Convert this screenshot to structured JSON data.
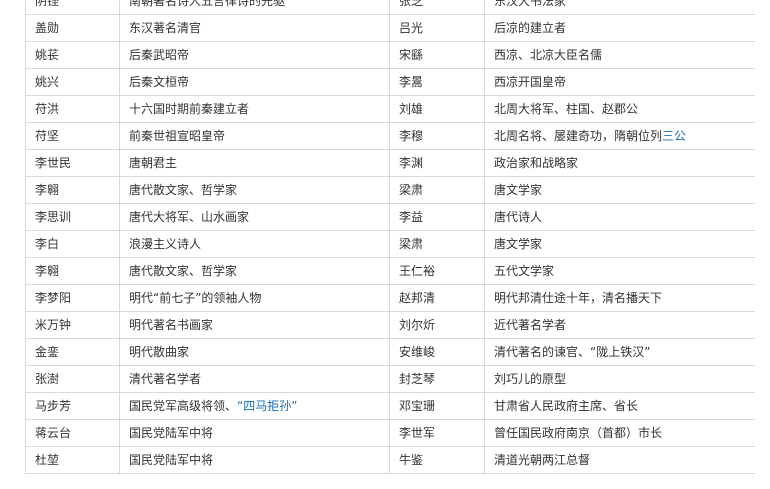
{
  "colors": {
    "link": "#136ec2",
    "text": "#333333",
    "border": "#d8d8d8"
  },
  "rows": [
    {
      "name1": "阴铿",
      "desc1": "南朝著名诗人五言律诗的先驱",
      "name2": "张芝",
      "desc2": "东汉大书法家"
    },
    {
      "name1": "盖勋",
      "desc1": "东汉著名清官",
      "name2": "吕光",
      "desc2": "后凉的建立者"
    },
    {
      "name1": "姚苌",
      "desc1": "后秦武昭帝",
      "name2": "宋繇",
      "desc2": "西凉、北凉大臣名儒"
    },
    {
      "name1": "姚兴",
      "desc1": "后秦文桓帝",
      "desc1_link": true,
      "name2": "李暠",
      "desc2": "西凉开国皇帝"
    },
    {
      "name1": "苻洪",
      "desc1": "十六国时期前秦建立者",
      "name2": "刘雄",
      "desc2": "北周大将军、柱国、赵郡公"
    },
    {
      "name1": "苻坚",
      "desc1": "前秦世祖宣昭皇帝",
      "name2": "李穆",
      "desc2_pre": "北周名将、屡建奇功，隋朝位列",
      "desc2_link": "三公"
    },
    {
      "name1": "李世民",
      "desc1": "唐朝君主",
      "name2": "李渊",
      "desc2": "政治家和战略家"
    },
    {
      "name1": "李翱",
      "desc1": "唐代散文家、哲学家",
      "name2": "梁肃",
      "desc2": "唐文学家"
    },
    {
      "name1": "李思训",
      "desc1": "唐代大将军、山水画家",
      "name2": "李益",
      "desc2": "唐代诗人"
    },
    {
      "name1": "李白",
      "desc1": "浪漫主义诗人",
      "name2": "梁肃",
      "desc2": "唐文学家"
    },
    {
      "name1": "李翱",
      "desc1": "唐代散文家、哲学家",
      "name2": "王仁裕",
      "desc2": "五代文学家"
    },
    {
      "name1": "李梦阳",
      "desc1": "明代“前七子”的领袖人物",
      "name2": "赵邦清",
      "desc2": "明代邦清仕途十年，清名播天下"
    },
    {
      "name1": "米万钟",
      "desc1": "明代著名书画家",
      "name2": "刘尔炘",
      "desc2": "近代著名学者"
    },
    {
      "name1": "金銮",
      "desc1": "明代散曲家",
      "name2": "安维峻",
      "desc2": "清代著名的谏官、“陇上铁汉”"
    },
    {
      "name1": "张澍",
      "desc1": "清代著名学者",
      "name2": "封芝琴",
      "desc2": "刘巧儿的原型"
    },
    {
      "name1": "马步芳",
      "desc1_pre": "国民党军高级将领、",
      "desc1_link": "“四马拒孙”",
      "name2": "邓宝珊",
      "desc2": "甘肃省人民政府主席、省长"
    },
    {
      "name1": "蒋云台",
      "desc1": "国民党陆军中将",
      "name2": "李世军",
      "desc2": "曾任国民政府南京（首都）市长"
    },
    {
      "name1": "杜堃",
      "desc1": "国民党陆军中将",
      "name2": "牛鉴",
      "desc2": "清道光朝两江总督"
    }
  ]
}
